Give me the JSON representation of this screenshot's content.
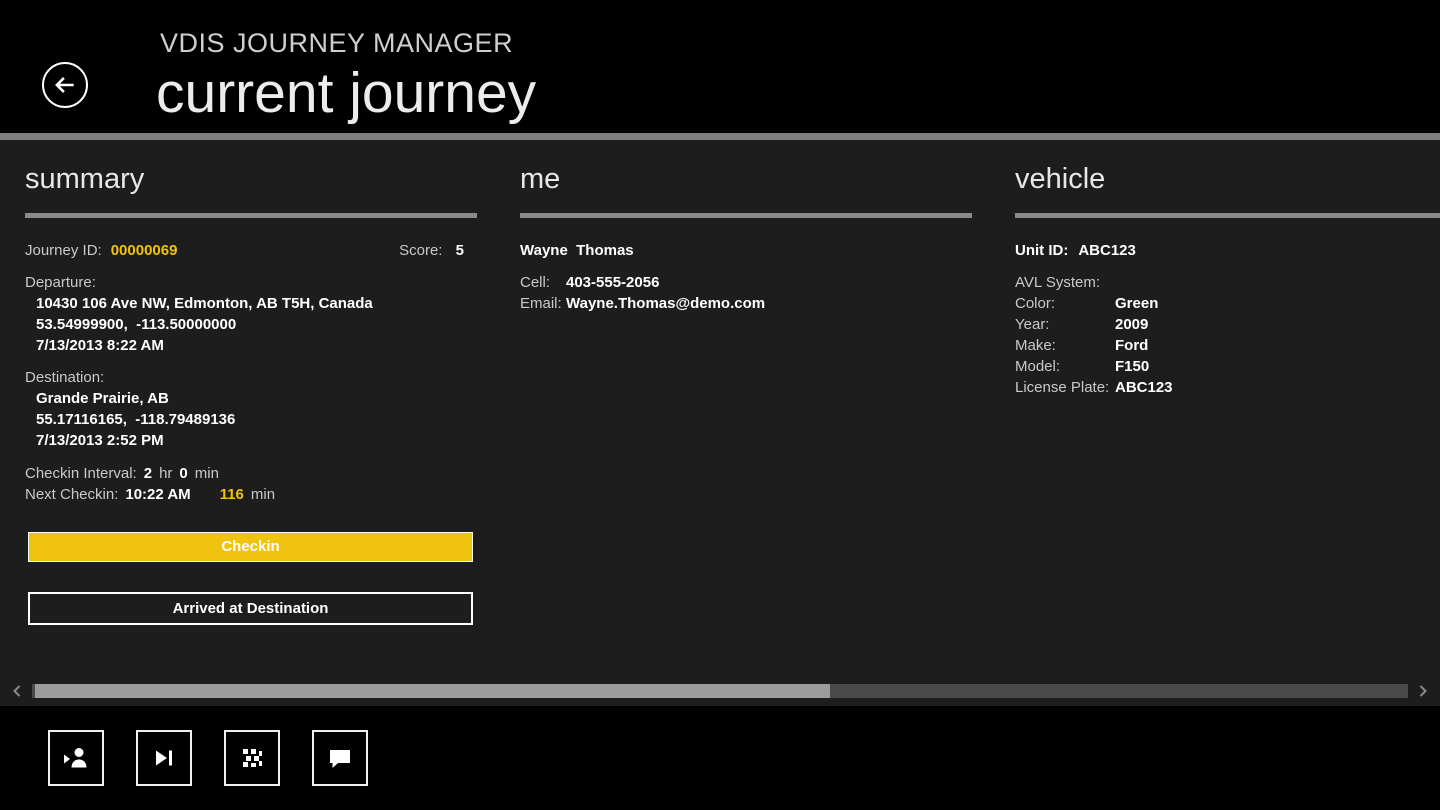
{
  "header": {
    "app_title": "VDIS JOURNEY MANAGER",
    "page_title": "current journey"
  },
  "summary": {
    "heading": "summary",
    "journey_id_label": "Journey ID:",
    "journey_id": "00000069",
    "score_label": "Score:",
    "score": "5",
    "departure_label": "Departure:",
    "departure_address": "10430 106 Ave NW, Edmonton, AB T5H, Canada",
    "departure_coords": "53.54999900,  -113.50000000",
    "departure_time": "7/13/2013 8:22 AM",
    "destination_label": "Destination:",
    "destination_address": "Grande Prairie, AB",
    "destination_coords": "55.17116165,  -118.79489136",
    "destination_time": "7/13/2013 2:52 PM",
    "checkin_interval_label": "Checkin Interval:",
    "checkin_interval_hr": "2",
    "hr_label": "hr",
    "checkin_interval_min": "0",
    "min_label": "min",
    "next_checkin_label": "Next Checkin:",
    "next_checkin_time": "10:22 AM",
    "next_checkin_min": "116",
    "next_checkin_min_label": "min",
    "checkin_button": "Checkin",
    "arrived_button": "Arrived at Destination"
  },
  "me": {
    "heading": "me",
    "name": "Wayne  Thomas",
    "cell_label": "Cell:",
    "cell": "403-555-2056",
    "email_label": "Email:",
    "email": "Wayne.Thomas@demo.com"
  },
  "vehicle": {
    "heading": "vehicle",
    "unit_id_label": "Unit ID:",
    "unit_id": "ABC123",
    "rows": [
      {
        "label": "AVL System:",
        "value": ""
      },
      {
        "label": "Color:",
        "value": "Green"
      },
      {
        "label": "Year:",
        "value": "2009"
      },
      {
        "label": "Make:",
        "value": "Ford"
      },
      {
        "label": "Model:",
        "value": "F150"
      },
      {
        "label": "License Plate:",
        "value": "ABC123"
      }
    ]
  },
  "appbar": {
    "icons": [
      "checkin-person-icon",
      "skip-next-icon",
      "map-icon",
      "comment-icon"
    ]
  },
  "colors": {
    "accent_yellow": "#f0c30f",
    "background": "#1d1d1d",
    "header_bg": "#000000",
    "divider_gray": "#7d7d7d"
  }
}
